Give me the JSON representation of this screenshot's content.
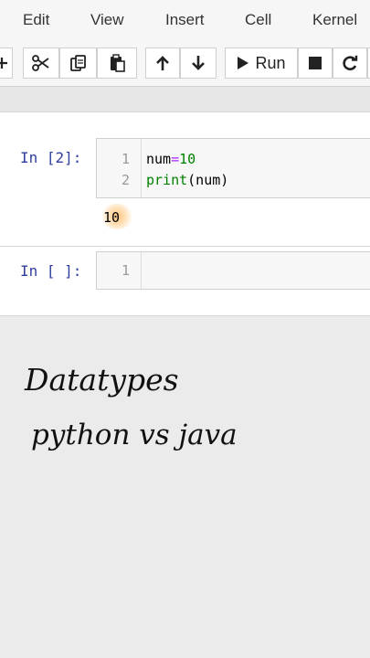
{
  "menu": {
    "items": [
      "Edit",
      "View",
      "Insert",
      "Cell",
      "Kernel"
    ]
  },
  "toolbar": {
    "run_label": "Run",
    "icons": [
      "add-icon",
      "cut-icon",
      "copy-icon",
      "paste-icon",
      "move-up-icon",
      "move-down-icon",
      "run-icon",
      "stop-icon",
      "restart-icon"
    ]
  },
  "cells": [
    {
      "prompt": "In [2]:",
      "lines": [
        {
          "num": "1",
          "code": "num=10"
        },
        {
          "num": "2",
          "code": "print(num)"
        }
      ],
      "output": "10"
    },
    {
      "prompt": "In [ ]:",
      "lines": [
        {
          "num": "1",
          "code": ""
        }
      ]
    }
  ],
  "caption": {
    "line1": "Datatypes",
    "line2": "python vs java"
  },
  "colors": {
    "prompt": "#303f9f",
    "keyword": "#008000",
    "operator": "#aa22ff",
    "highlight": "#ffbe6e"
  }
}
